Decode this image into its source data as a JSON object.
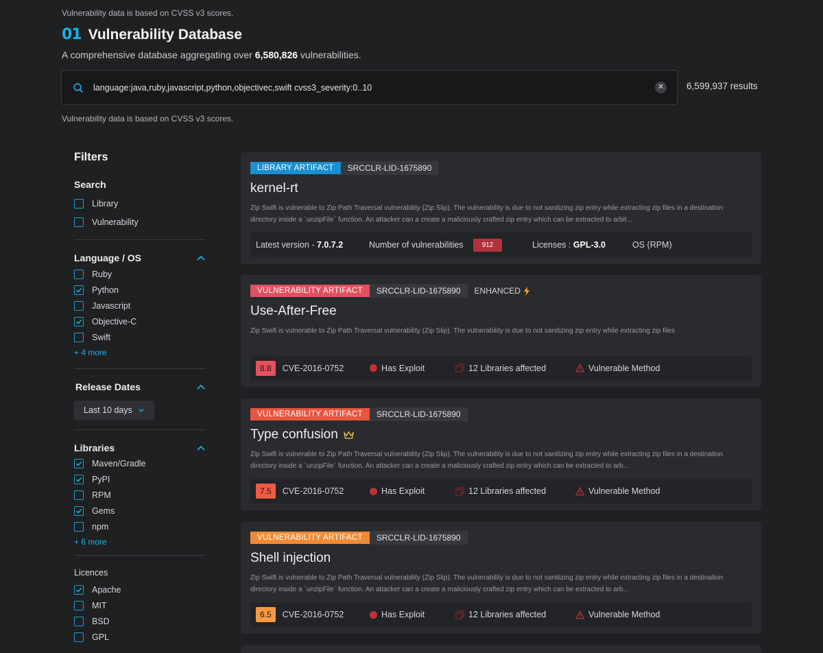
{
  "header": {
    "top_note": "Vulnerability data is based on CVSS v3 scores.",
    "logo": "01",
    "title": "Vulnerability Database",
    "subtitle_prefix": "A comprehensive database aggregating over ",
    "subtitle_count": "6,580,826",
    "subtitle_suffix": " vulnerabilities."
  },
  "search": {
    "query": "language:java,ruby,javascript,python,objectivec,swift cvss3_severity:0..10",
    "results": "6,599,937 results",
    "note": "Vulnerability data is based on CVSS v3 scores."
  },
  "sidebar": {
    "title": "Filters",
    "search": {
      "title": "Search",
      "items": [
        {
          "label": "Library",
          "checked": false
        },
        {
          "label": "Vulnerability",
          "checked": false
        }
      ]
    },
    "language": {
      "title": "Language / OS",
      "items": [
        {
          "label": "Ruby",
          "checked": false
        },
        {
          "label": "Python",
          "checked": true
        },
        {
          "label": "Javascript",
          "checked": false
        },
        {
          "label": "Objective-C",
          "checked": true
        },
        {
          "label": "Swift",
          "checked": false
        }
      ],
      "more": "+ 4 more"
    },
    "release": {
      "title": "Release Dates",
      "dropdown": "Last 10 days"
    },
    "libraries": {
      "title": "Libraries",
      "items": [
        {
          "label": "Maven/Gradle",
          "checked": true
        },
        {
          "label": "PyPI",
          "checked": true
        },
        {
          "label": "RPM",
          "checked": false
        },
        {
          "label": "Gems",
          "checked": true
        },
        {
          "label": "npm",
          "checked": false
        }
      ],
      "more": "+ 6 more"
    },
    "licences": {
      "title": "Licences",
      "items": [
        {
          "label": "Apache",
          "checked": true
        },
        {
          "label": "MIT",
          "checked": false
        },
        {
          "label": "BSD",
          "checked": false
        },
        {
          "label": "GPL",
          "checked": false
        }
      ]
    }
  },
  "cards": {
    "c1": {
      "tag": "LIBRARY ARTIFACT",
      "tag_color": "#1a8fd0",
      "id": "SRCCLR-LID-1675890",
      "title": "kernel-rt",
      "desc": "Zip Swift is vulnerable to Zip Path Traversal vulnerability (Zip Slip). The vulnerability is due to not sanitizing zip entry while extracting zip files in a destination directory inside a `unzipFile` function. An attacker can a create a maliciously crafted zip entry which can be extracted to arbit...",
      "latest_label": "Latest version - ",
      "latest_value": "7.0.7.2",
      "vuln_label": "Number of vulnerabilities",
      "vuln_count": "912",
      "licenses_label": "Licenses : ",
      "licenses_value": "GPL-3.0",
      "os": "OS (RPM)"
    },
    "c2": {
      "tag": "VULNERABILITY ARTIFACT",
      "tag_color": "#e0505e",
      "id": "SRCCLR-LID-1675890",
      "enhanced": "ENHANCED",
      "title": "Use-After-Free",
      "desc": "Zip Swift is vulnerable to Zip Path Traversal vulnerability (Zip Slip). The vulnerability is due to not sanitizing zip entry while extracting zip files",
      "score": "8.8",
      "score_color": "#e8505d",
      "cve": "CVE-2016-0752",
      "exploit": "Has Exploit",
      "libraries": "12 Libraries affected",
      "method": "Vulnerable Method"
    },
    "c3": {
      "tag": "VULNERABILITY ARTIFACT",
      "tag_color": "#ea5540",
      "id": "SRCCLR-LID-1675890",
      "title": "Type confusion",
      "desc": "Zip Swift is vulnerable to Zip Path Traversal vulnerability (Zip Slip). The vulnerability is due to not sanitizing zip entry while extracting zip files in a destination directory inside a `unzipFile` function. An attacker can a create a maliciously crafted zip entry which can be extracted to arb...",
      "score": "7.5",
      "score_color": "#ef5a43",
      "cve": "CVE-2016-0752",
      "exploit": "Has Exploit",
      "libraries": "12 Libraries affected",
      "method": "Vulnerable Method"
    },
    "c4": {
      "tag": "VULNERABILITY ARTIFACT",
      "tag_color": "#f08a35",
      "id": "SRCCLR-LID-1675890",
      "title": "Shell injection",
      "desc": "Zip Swift is vulnerable to Zip Path Traversal vulnerability (Zip Slip). The vulnerability is due to not sanitizing zip entry while extracting zip files in a destination directory inside a `unzipFile` function. An attacker can a create a maliciously crafted zip entry which can be extracted to arb...",
      "score": "6.5",
      "score_color": "#f49a45",
      "cve": "CVE-2016-0752",
      "exploit": "Has Exploit",
      "libraries": "12 Libraries affected",
      "method": "Vulnerable Method"
    }
  }
}
